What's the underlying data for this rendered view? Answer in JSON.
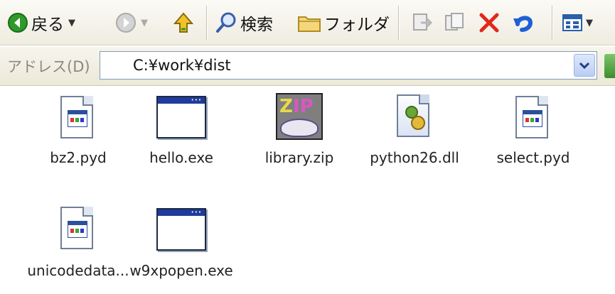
{
  "toolbar": {
    "back_label": "戻る",
    "search_label": "検索",
    "folders_label": "フォルダ"
  },
  "addressbar": {
    "label": "アドレス(D)",
    "value": "C:¥work¥dist"
  },
  "files": [
    {
      "name": "bz2.pyd",
      "type": "pyd"
    },
    {
      "name": "hello.exe",
      "type": "exe"
    },
    {
      "name": "library.zip",
      "type": "zip"
    },
    {
      "name": "python26.dll",
      "type": "dll"
    },
    {
      "name": "select.pyd",
      "type": "pyd"
    },
    {
      "name": "unicodedata...",
      "type": "pyd"
    },
    {
      "name": "w9xpopen.exe",
      "type": "exe"
    }
  ],
  "colors": {
    "back_green": "#2f9a2a",
    "delete_red": "#e0281c",
    "undo_blue": "#1f5fd6",
    "up_yellow": "#f2c229"
  }
}
